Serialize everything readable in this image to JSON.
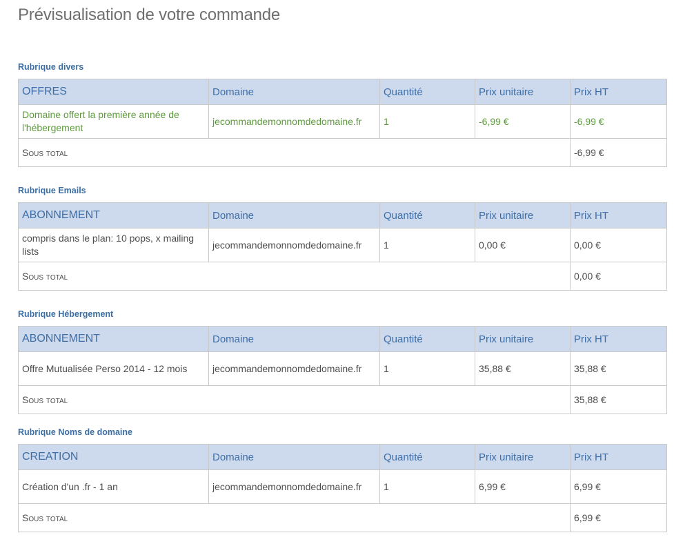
{
  "page_title": "Prévisualisation de votre commande",
  "columns": {
    "domain": "Domaine",
    "qty": "Quantité",
    "unit": "Prix unitaire",
    "total": "Prix HT"
  },
  "subtotal_label": "Sous total",
  "sections": [
    {
      "title": "Rubrique divers",
      "first_header": "OFFRES",
      "row": {
        "detail": "Domaine offert la première année de l'hébergement",
        "domain": "jecommandemonnomdedomaine.fr",
        "qty": "1",
        "unit": "-6,99 €",
        "total": "-6,99 €"
      },
      "subtotal": "-6,99 €"
    },
    {
      "title": "Rubrique Emails",
      "first_header": "ABONNEMENT",
      "row": {
        "detail": "compris dans le plan: 10 pops, x mailing lists",
        "domain": "jecommandemonnomdedomaine.fr",
        "qty": "1",
        "unit": "0,00 €",
        "total": "0,00 €"
      },
      "subtotal": "0,00 €"
    },
    {
      "title": "Rubrique Hébergement",
      "first_header": "ABONNEMENT",
      "row": {
        "detail": "Offre Mutualisée Perso 2014 - 12 mois",
        "domain": "jecommandemonnomdedomaine.fr",
        "qty": "1",
        "unit": "35,88 €",
        "total": "35,88 €"
      },
      "subtotal": "35,88 €"
    },
    {
      "title": "Rubrique Noms de domaine",
      "first_header": "CREATION",
      "row": {
        "detail": "Création d'un .fr - 1 an",
        "domain": "jecommandemonnomdedomaine.fr",
        "qty": "1",
        "unit": "6,99 €",
        "total": "6,99 €"
      },
      "subtotal": "6,99 €"
    }
  ]
}
